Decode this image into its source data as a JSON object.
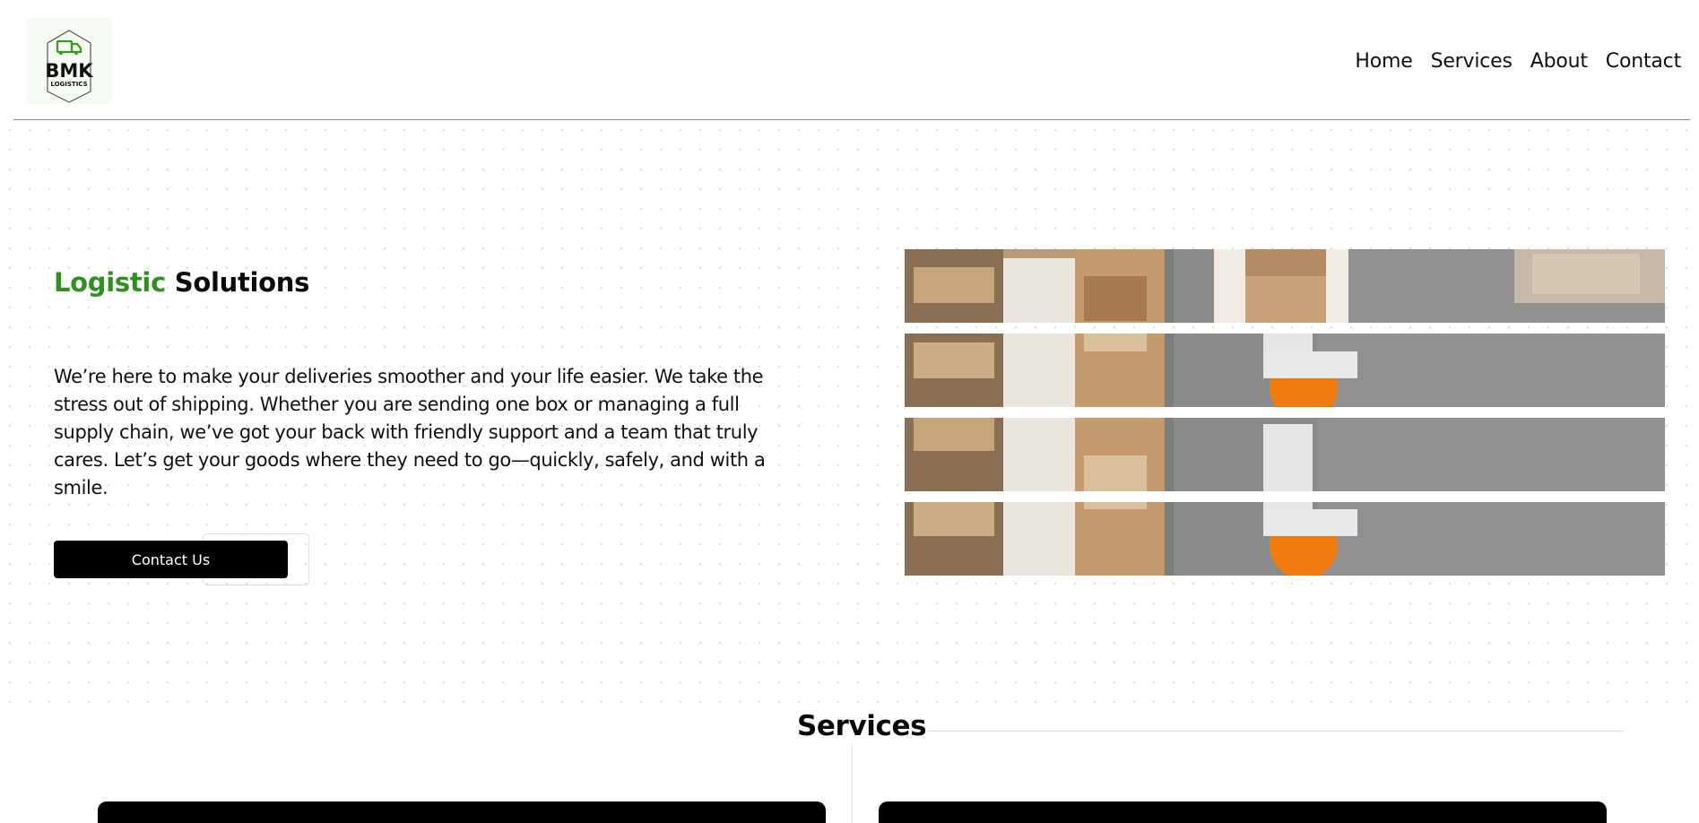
{
  "brand": {
    "logo_name": "BMK",
    "logo_sub": "LOGISTICS",
    "logo_icon": "truck-icon",
    "accent_color": "#2f8f1f"
  },
  "nav": {
    "items": [
      {
        "label": "Home"
      },
      {
        "label": "Services"
      },
      {
        "label": "About"
      },
      {
        "label": "Contact"
      }
    ]
  },
  "hero": {
    "title_accent": "Logistic",
    "title_rest": " Solutions",
    "body": "We’re here to make your deliveries smoother and your life easier. We take the stress out of shipping. Whether you are sending one box or managing a full supply chain, we’ve got your back with friendly support and a team that truly cares. Let’s get your goods where they need to go—quickly, safely, and with a smile.",
    "cta_label": "Contact Us",
    "image_subject": "warehouse-worker-photo"
  },
  "services": {
    "heading": "Services"
  }
}
